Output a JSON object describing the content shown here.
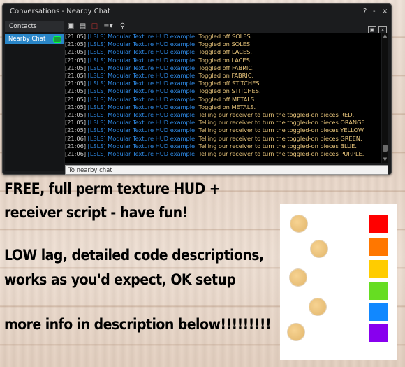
{
  "window": {
    "title": "Conversations - Nearby Chat",
    "controls": [
      "?",
      "-",
      "×"
    ]
  },
  "contacts": {
    "header": "Contacts",
    "items": [
      {
        "label": "Nearby Chat"
      }
    ]
  },
  "chat": {
    "source": "[LSLS] Modular Texture HUD example:",
    "lines": [
      {
        "time": "[21:05]",
        "text": "Toggled off SOLES."
      },
      {
        "time": "[21:05]",
        "text": "Toggled on SOLES."
      },
      {
        "time": "[21:05]",
        "text": "Toggled off LACES."
      },
      {
        "time": "[21:05]",
        "text": "Toggled on LACES."
      },
      {
        "time": "[21:05]",
        "text": "Toggled off FABRIC."
      },
      {
        "time": "[21:05]",
        "text": "Toggled on FABRIC."
      },
      {
        "time": "[21:05]",
        "text": "Toggled off STITCHES."
      },
      {
        "time": "[21:05]",
        "text": "Toggled on STITCHES."
      },
      {
        "time": "[21:05]",
        "text": "Toggled off METALS."
      },
      {
        "time": "[21:05]",
        "text": "Toggled on METALS."
      },
      {
        "time": "[21:05]",
        "text": "Telling our receiver to turn the toggled-on pieces RED."
      },
      {
        "time": "[21:05]",
        "text": "Telling our receiver to turn the toggled-on pieces ORANGE."
      },
      {
        "time": "[21:05]",
        "text": "Telling our receiver to turn the toggled-on pieces YELLOW."
      },
      {
        "time": "[21:06]",
        "text": "Telling our receiver to turn the toggled-on pieces GREEN."
      },
      {
        "time": "[21:06]",
        "text": "Telling our receiver to turn the toggled-on pieces BLUE."
      },
      {
        "time": "[21:06]",
        "text": "Telling our receiver to turn the toggled-on pieces PURPLE."
      }
    ],
    "input_placeholder": "To nearby chat"
  },
  "promo": {
    "line1": "FREE, full perm texture HUD +",
    "line2": "receiver script - have fun!",
    "line3": "LOW lag, detailed code descriptions,",
    "line4": "works as you'd expect, OK setup",
    "line5": "more info in description below!!!!!!!!!"
  },
  "swatches": [
    "#ff0000",
    "#ff7700",
    "#ffcc00",
    "#66dd22",
    "#1188ff",
    "#8800ee"
  ],
  "icons": [
    "conversation-icon",
    "voice-icon",
    "speech-bubble-icon",
    "list-options-icon",
    "search-icon",
    "panel-toggle-icon",
    "help-icon",
    "minimize-icon",
    "close-icon"
  ]
}
